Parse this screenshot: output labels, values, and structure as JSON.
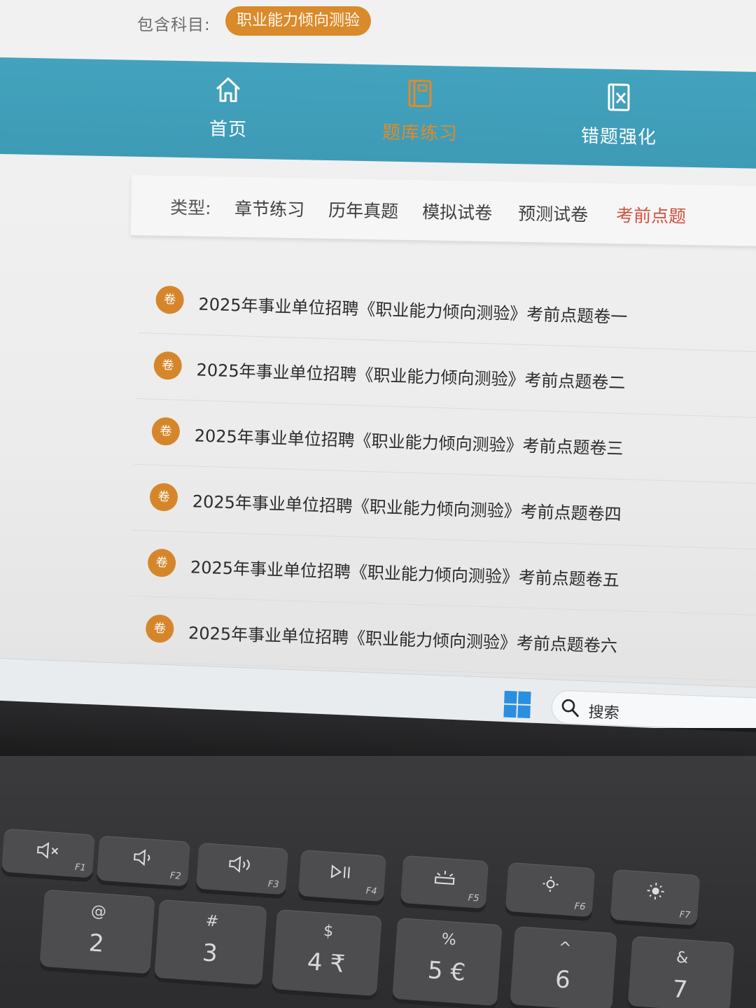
{
  "subject": {
    "label": "包含科目:",
    "value": "职业能力倾向测验"
  },
  "nav": {
    "items": [
      {
        "label": "首页",
        "icon": "home-icon"
      },
      {
        "label": "题库练习",
        "icon": "book-icon",
        "active": true
      },
      {
        "label": "错题强化",
        "icon": "wrong-paper-icon"
      }
    ]
  },
  "types": {
    "label": "类型:",
    "tabs": [
      "章节练习",
      "历年真题",
      "模拟试卷",
      "预测试卷",
      "考前点题"
    ],
    "active": "考前点题"
  },
  "papers": {
    "badge": "卷",
    "items": [
      "2025年事业单位招聘《职业能力倾向测验》考前点题卷一",
      "2025年事业单位招聘《职业能力倾向测验》考前点题卷二",
      "2025年事业单位招聘《职业能力倾向测验》考前点题卷三",
      "2025年事业单位招聘《职业能力倾向测验》考前点题卷四",
      "2025年事业单位招聘《职业能力倾向测验》考前点题卷五",
      "2025年事业单位招聘《职业能力倾向测验》考前点题卷六"
    ]
  },
  "taskbar": {
    "search_label": "搜索",
    "icons": [
      "windows-start-icon",
      "search-icon"
    ]
  },
  "keyboard": {
    "fkeys": [
      {
        "fn": "F1",
        "icon": "mute-icon"
      },
      {
        "fn": "F2",
        "icon": "volume-down-icon"
      },
      {
        "fn": "F3",
        "icon": "volume-up-icon"
      },
      {
        "fn": "F4",
        "icon": "play-pause-icon"
      },
      {
        "fn": "F5",
        "icon": "keyboard-backlight-icon"
      },
      {
        "fn": "F6",
        "icon": "brightness-down-icon"
      },
      {
        "fn": "F7",
        "icon": "brightness-up-icon"
      }
    ],
    "number_keys": [
      {
        "top": "@",
        "main": "2"
      },
      {
        "top": "#",
        "main": "3"
      },
      {
        "top": "$",
        "main": "4 ₹"
      },
      {
        "top": "%",
        "main": "5 €"
      },
      {
        "top": "^",
        "main": "6"
      },
      {
        "top": "&",
        "main": "7"
      }
    ]
  },
  "colors": {
    "nav_bg": "#3d9bb6",
    "accent_orange": "#d98a2b",
    "active_tab_red": "#d0503f"
  }
}
